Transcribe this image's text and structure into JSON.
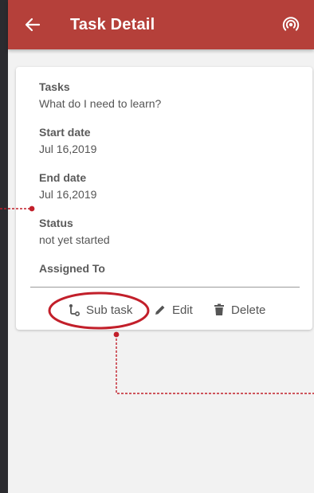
{
  "app_bar": {
    "title": "Task Detail",
    "back_icon": "arrow-left-icon",
    "action_icon": "broadcast-icon",
    "color": "#b5403a"
  },
  "task": {
    "fields": [
      {
        "label": "Tasks",
        "value": "What do I need to learn?"
      },
      {
        "label": "Start date",
        "value": "Jul 16,2019"
      },
      {
        "label": "End date",
        "value": "Jul 16,2019"
      },
      {
        "label": "Status",
        "value": "not yet started"
      },
      {
        "label": "Assigned To",
        "value": ""
      }
    ]
  },
  "actions": {
    "subtask_label": "Sub task",
    "edit_label": "Edit",
    "delete_label": "Delete"
  },
  "annotation_color": "#c21f2a"
}
